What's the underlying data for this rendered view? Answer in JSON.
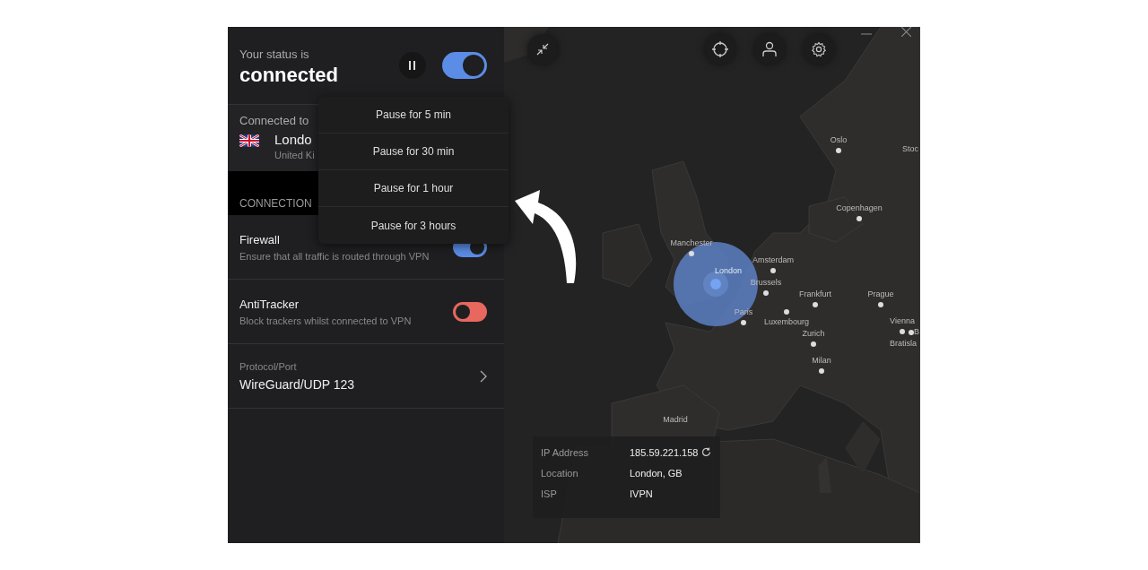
{
  "status": {
    "label": "Your status is",
    "value": "connected",
    "connected": true
  },
  "connection": {
    "label": "Connected to",
    "city": "Londo",
    "country": "United Ki"
  },
  "section_header": "CONNECTION",
  "settings": [
    {
      "kind": "toggle",
      "title": "Firewall",
      "description": "Ensure that all traffic is routed through VPN",
      "on": true,
      "color": "#5b8de6"
    },
    {
      "kind": "toggle",
      "title": "AntiTracker",
      "description": "Block trackers whilst connected to VPN",
      "on": false,
      "color": "#e8675e"
    },
    {
      "kind": "link",
      "title": "Protocol/Port",
      "value": "WireGuard/UDP 123"
    }
  ],
  "pause_menu": [
    "Pause for 5 min",
    "Pause for 30 min",
    "Pause for 1 hour",
    "Pause for 3 hours"
  ],
  "map": {
    "cities": [
      {
        "name": "Oslo",
        "selected": false
      },
      {
        "name": "Stoc",
        "selected": false
      },
      {
        "name": "Copenhagen",
        "selected": false
      },
      {
        "name": "Manchester",
        "selected": false
      },
      {
        "name": "London",
        "selected": true
      },
      {
        "name": "Amsterdam",
        "selected": false
      },
      {
        "name": "Brussels",
        "selected": false
      },
      {
        "name": "Frankfurt",
        "selected": false
      },
      {
        "name": "Prague",
        "selected": false
      },
      {
        "name": "Paris",
        "selected": false
      },
      {
        "name": "Luxembourg",
        "selected": false
      },
      {
        "name": "Zurich",
        "selected": false
      },
      {
        "name": "Vienna",
        "selected": false
      },
      {
        "name": "B",
        "selected": false
      },
      {
        "name": "Bratisla",
        "selected": false
      },
      {
        "name": "Milan",
        "selected": false
      },
      {
        "name": "Madrid",
        "selected": false
      }
    ]
  },
  "info": [
    {
      "label": "IP Address",
      "value": "185.59.221.158",
      "refresh": true
    },
    {
      "label": "Location",
      "value": "London, GB",
      "refresh": false
    },
    {
      "label": "ISP",
      "value": "IVPN",
      "refresh": false
    }
  ]
}
